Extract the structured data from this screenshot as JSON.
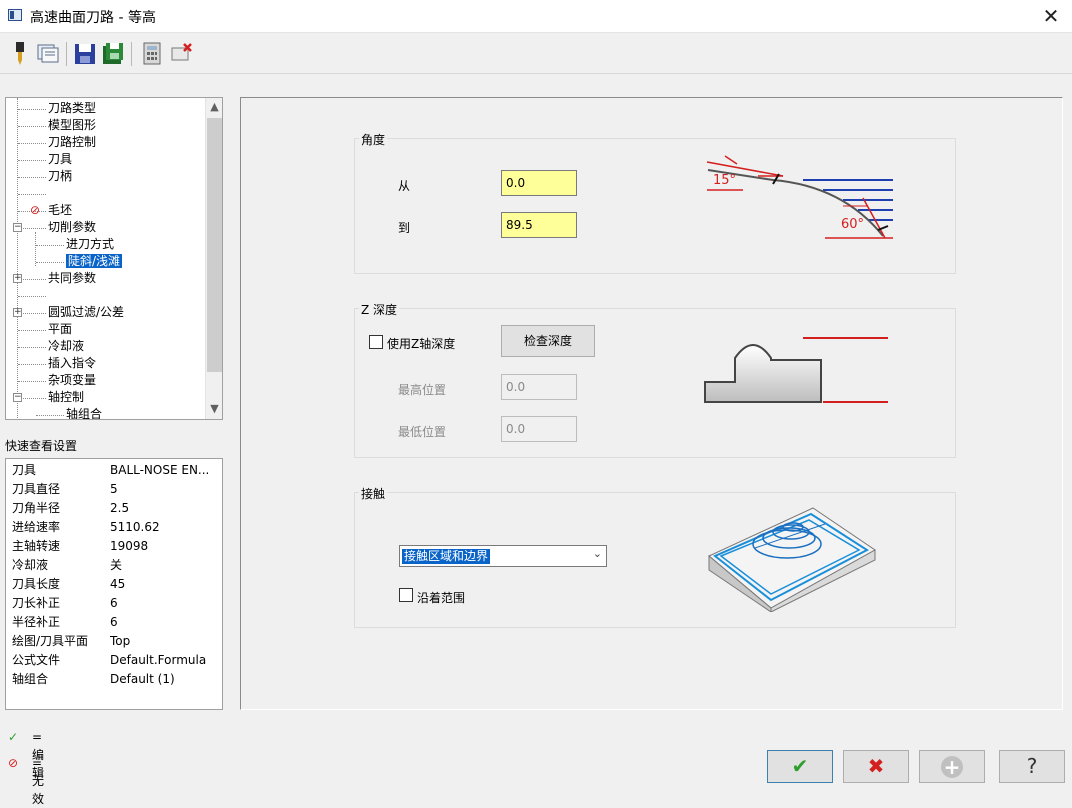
{
  "window": {
    "title": "高速曲面刀路 - 等高",
    "close_glyph": "✕"
  },
  "toolbar": {
    "icons": [
      "tool-icon",
      "view-icon",
      "save-icon",
      "save-all-icon",
      "calculator-icon",
      "delete-icon"
    ]
  },
  "tree": {
    "items": [
      {
        "label": "刀路类型"
      },
      {
        "label": "模型图形"
      },
      {
        "label": "刀路控制"
      },
      {
        "label": "刀具"
      },
      {
        "label": "刀柄"
      },
      {
        "label": ""
      },
      {
        "label": "毛坯",
        "invalid_glyph": "⊘"
      },
      {
        "label": "切削参数",
        "expander": "−"
      },
      {
        "label": "进刀方式"
      },
      {
        "label": "陡斜/浅滩"
      },
      {
        "label": "共同参数",
        "expander": "+"
      },
      {
        "label": ""
      },
      {
        "label": "圆弧过滤/公差",
        "expander": "+"
      },
      {
        "label": "平面"
      },
      {
        "label": "冷却液"
      },
      {
        "label": "插入指令"
      },
      {
        "label": "杂项变量"
      },
      {
        "label": "轴控制",
        "expander": "−"
      },
      {
        "label": "轴组合"
      }
    ],
    "scroll_up": "▲",
    "scroll_down": "▼"
  },
  "quick_view": {
    "title": "快速查看设置",
    "rows": [
      {
        "key": "刀具",
        "value": "BALL-NOSE EN..."
      },
      {
        "key": "刀具直径",
        "value": "5"
      },
      {
        "key": "刀角半径",
        "value": "2.5"
      },
      {
        "key": "进给速率",
        "value": "5110.62"
      },
      {
        "key": "主轴转速",
        "value": "19098"
      },
      {
        "key": "冷却液",
        "value": "关"
      },
      {
        "key": "刀具长度",
        "value": "45"
      },
      {
        "key": "刀长补正",
        "value": "6"
      },
      {
        "key": "半径补正",
        "value": "6"
      },
      {
        "key": "绘图/刀具平面",
        "value": "Top"
      },
      {
        "key": "公式文件",
        "value": "Default.Formula"
      },
      {
        "key": "轴组合",
        "value": "Default (1)"
      }
    ]
  },
  "legend": {
    "edit_glyph": "✓",
    "edit_label": "=编辑",
    "invalid_glyph": "⊘",
    "invalid_label": "=无效"
  },
  "angle_group": {
    "title": "角度",
    "from_label": "从",
    "from_value": "0.0",
    "to_label": "到",
    "to_value": "89.5",
    "diagram_label_15": "15°",
    "diagram_label_60": "60°"
  },
  "z_depth_group": {
    "title": "Z 深度",
    "use_z_label": "使用Z轴深度",
    "use_z_checked": false,
    "check_depth_button": "检查深度",
    "top_label": "最高位置",
    "top_value": "0.0",
    "bottom_label": "最低位置",
    "bottom_value": "0.0"
  },
  "contact_group": {
    "title": "接触",
    "select_value": "接触区域和边界",
    "along_range_label": "沿着范围",
    "along_range_checked": false
  },
  "dialog_buttons": {
    "ok_glyph": "✔",
    "cancel_glyph": "✖",
    "add_glyph": "+",
    "help_glyph": "?"
  },
  "colors": {
    "ok": "#2e9e2e",
    "cancel": "#d41f1f",
    "input_yellow": "#ffff99",
    "selection": "#0a64c8"
  }
}
